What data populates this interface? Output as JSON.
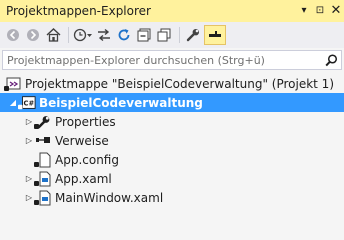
{
  "panel": {
    "title": "Projektmappen-Explorer",
    "title_controls": [
      "▾",
      "⊡",
      "✕"
    ]
  },
  "toolbar": {
    "buttons": [
      {
        "name": "back-icon",
        "glyph": "◀",
        "enabled": false
      },
      {
        "name": "forward-icon",
        "glyph": "▶",
        "enabled": false
      },
      {
        "name": "home-icon",
        "glyph": "⌂",
        "enabled": true
      },
      {
        "name": "pending-changes-filter-icon",
        "glyph": "⏲",
        "enabled": true
      },
      {
        "name": "sync-with-document-icon",
        "glyph": "⇆",
        "enabled": true
      },
      {
        "name": "refresh-icon",
        "glyph": "↻",
        "enabled": true
      },
      {
        "name": "collapse-all-icon",
        "glyph": "⊟",
        "enabled": true
      },
      {
        "name": "show-all-files-icon",
        "glyph": "❐",
        "enabled": true
      },
      {
        "name": "properties-icon",
        "glyph": "🔧",
        "enabled": true
      },
      {
        "name": "preview-selected-items-icon",
        "glyph": "▬",
        "enabled": true,
        "active": true
      }
    ]
  },
  "search": {
    "placeholder": "Projektmappen-Explorer durchsuchen (Strg+ü)",
    "value": ""
  },
  "tree": {
    "solution": {
      "label": "Projektmappe \"BeispielCodeverwaltung\" (Projekt 1)"
    },
    "project": {
      "label": "BeispielCodeverwaltung",
      "badge": "C#"
    },
    "items": [
      {
        "label": "Properties",
        "icon": "wrench-icon",
        "expandable": true
      },
      {
        "label": "Verweise",
        "icon": "references-icon",
        "expandable": true
      },
      {
        "label": "App.config",
        "icon": "config-file-icon",
        "expandable": false
      },
      {
        "label": "App.xaml",
        "icon": "xaml-file-icon",
        "expandable": true
      },
      {
        "label": "MainWindow.xaml",
        "icon": "xaml-file-icon",
        "expandable": true
      }
    ]
  },
  "colors": {
    "title_bar": "#fff29d",
    "selection": "#3399ff",
    "background": "#f5f5f5"
  }
}
